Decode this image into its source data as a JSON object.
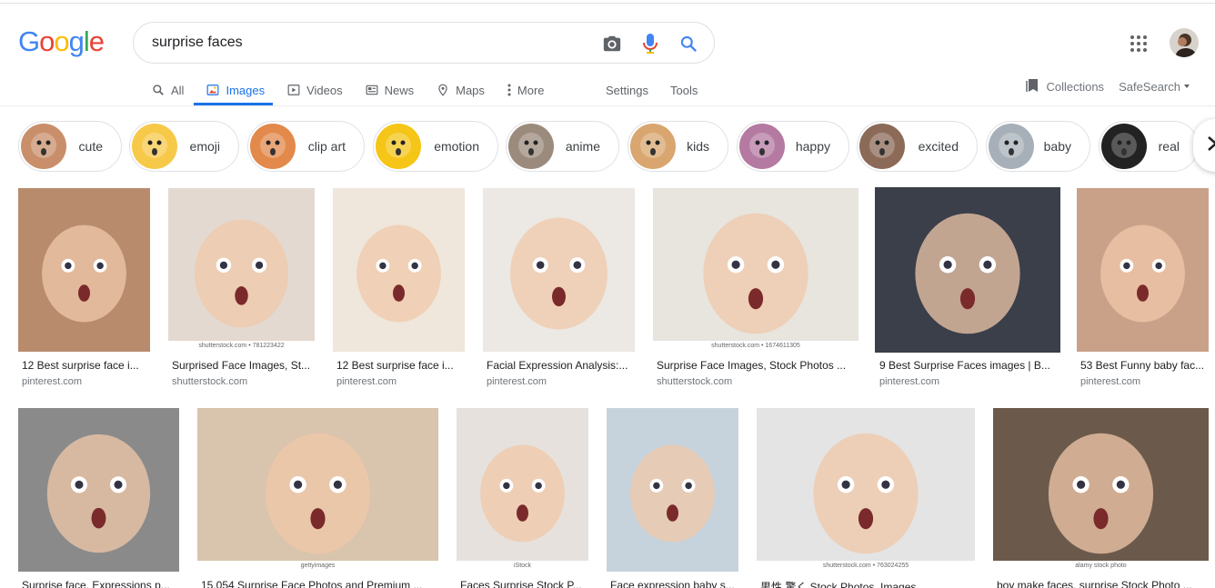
{
  "brand": {
    "logo_letters": [
      "G",
      "o",
      "o",
      "g",
      "l",
      "e"
    ],
    "logo_colors": [
      "#4285F4",
      "#EA4335",
      "#FBBC05",
      "#4285F4",
      "#34A853",
      "#EA4335"
    ]
  },
  "search": {
    "query": "surprise faces",
    "icons": [
      "camera-icon",
      "microphone-icon",
      "search-icon"
    ]
  },
  "tabs": [
    {
      "label": "All",
      "icon": "search-icon",
      "active": false
    },
    {
      "label": "Images",
      "icon": "image-icon",
      "active": true
    },
    {
      "label": "Videos",
      "icon": "video-icon",
      "active": false
    },
    {
      "label": "News",
      "icon": "news-icon",
      "active": false
    },
    {
      "label": "Maps",
      "icon": "map-pin-icon",
      "active": false
    },
    {
      "label": "More",
      "icon": "more-vert-icon",
      "active": false
    }
  ],
  "tools": {
    "settings": "Settings",
    "tools": "Tools"
  },
  "right": {
    "collections": "Collections",
    "safesearch": "SafeSearch"
  },
  "chips": [
    {
      "label": "cute",
      "thumb_color": "#c98f6a"
    },
    {
      "label": "emoji",
      "thumb_color": "#f7c948"
    },
    {
      "label": "clip art",
      "thumb_color": "#e2894b"
    },
    {
      "label": "emotion",
      "thumb_color": "#f5c518"
    },
    {
      "label": "anime",
      "thumb_color": "#9b8b7d"
    },
    {
      "label": "kids",
      "thumb_color": "#d9a66f"
    },
    {
      "label": "happy",
      "thumb_color": "#b47aa2"
    },
    {
      "label": "excited",
      "thumb_color": "#8c6a58"
    },
    {
      "label": "baby",
      "thumb_color": "#a7b0b8"
    },
    {
      "label": "real",
      "thumb_color": "#222222"
    }
  ],
  "results_row1": [
    {
      "title": "12 Best surprise face i...",
      "site": "pinterest.com",
      "bg": "#b88b6d",
      "watermark": ""
    },
    {
      "title": "Surprised Face Images, St...",
      "site": "shutterstock.com",
      "bg": "#e3d9d0",
      "watermark": "shutterstock.com • 781223422"
    },
    {
      "title": "12 Best surprise face i...",
      "site": "pinterest.com",
      "bg": "#efe6dc",
      "watermark": ""
    },
    {
      "title": "Facial Expression Analysis:...",
      "site": "pinterest.com",
      "bg": "#ece8e3",
      "watermark": ""
    },
    {
      "title": "Surprise Face Images, Stock Photos ...",
      "site": "shutterstock.com",
      "bg": "#e8e4de",
      "watermark": "shutterstock.com • 1674611305"
    },
    {
      "title": "9 Best Surprise Faces images | B...",
      "site": "pinterest.com",
      "bg": "#3a3f4a",
      "watermark": ""
    },
    {
      "title": "53 Best Funny baby fac...",
      "site": "pinterest.com",
      "bg": "#c9a189",
      "watermark": ""
    }
  ],
  "results_row2": [
    {
      "title": "Surprise face. Expressions p...",
      "bg": "#8a8a8a",
      "watermark": ""
    },
    {
      "title": "15,054 Surprise Face Photos and Premium ...",
      "bg": "#d9c4ad",
      "watermark": "gettyimages"
    },
    {
      "title": "Faces Surprise Stock P...",
      "bg": "#e6e1dc",
      "watermark": "iStock"
    },
    {
      "title": "Face expression baby s...",
      "bg": "#c7d3dc",
      "watermark": ""
    },
    {
      "title": "男性 驚く Stock Photos, Images ...",
      "bg": "#e4e4e4",
      "watermark": "shutterstock.com • 763024255"
    },
    {
      "title": "boy make faces, surprise Stock Photo ...",
      "bg": "#6b5a4c",
      "watermark": "alamy stock photo"
    }
  ]
}
